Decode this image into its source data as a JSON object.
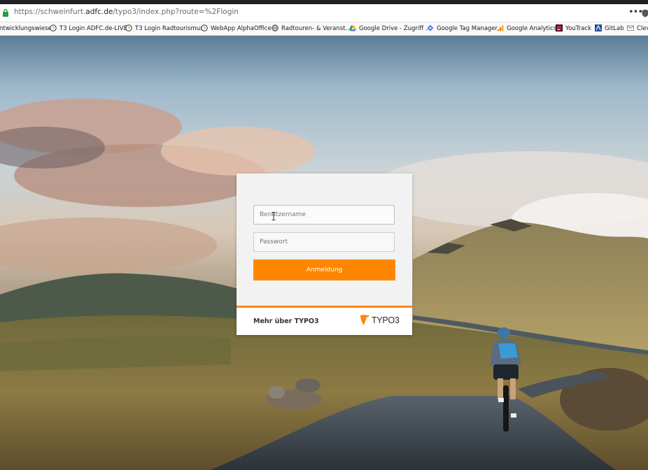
{
  "browser": {
    "url_prefix": "https://schweinfurt.",
    "url_domain": "adfc.de",
    "url_path": "/typo3/index.php?route=%2Flogin",
    "menu_label": "•••"
  },
  "bookmarks": [
    {
      "label": "ntwicklungswiese",
      "icon": "none"
    },
    {
      "label": "T3 Login ADFC.de-LIVE",
      "icon": "clock-icon"
    },
    {
      "label": "T3 Login Radtourismus",
      "icon": "clock-icon"
    },
    {
      "label": "WebApp AlphaOffice",
      "icon": "clock-icon"
    },
    {
      "label": "Radtouren- & Veranst...",
      "icon": "globe-icon"
    },
    {
      "label": "Google Drive - Zugriff ...",
      "icon": "drive-icon"
    },
    {
      "label": "Google Tag Manager",
      "icon": "tag-manager-icon"
    },
    {
      "label": "Google Analytics",
      "icon": "analytics-icon"
    },
    {
      "label": "YouTrack",
      "icon": "youtrack-icon"
    },
    {
      "label": "GitLab",
      "icon": "gitlab-icon"
    },
    {
      "label": "Clev",
      "icon": "mail-icon"
    }
  ],
  "login": {
    "username_placeholder": "Benutzername",
    "password_placeholder": "Passwort",
    "submit_label": "Anmeldung",
    "more_link": "Mehr über TYPO3",
    "logo_text": "TYPO3"
  },
  "colors": {
    "accent": "#ff8700",
    "card": "#f2f2f2"
  }
}
